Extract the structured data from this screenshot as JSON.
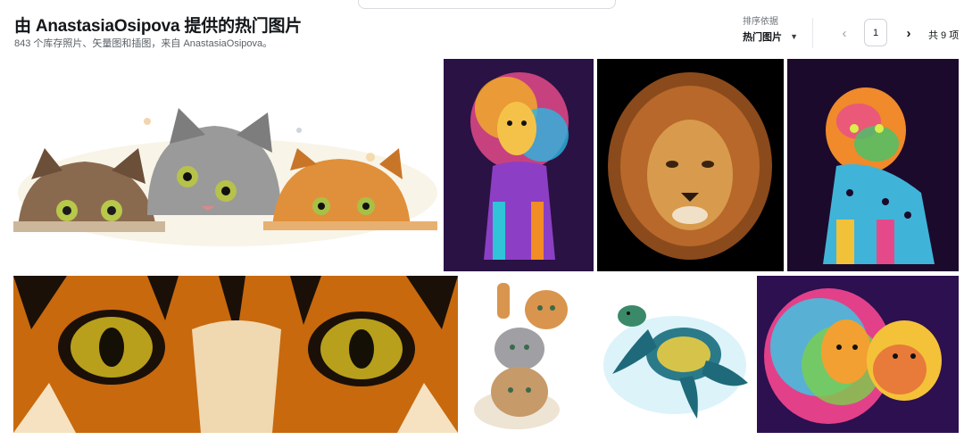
{
  "header": {
    "title": "由 AnastasiaOsipova 提供的热门图片",
    "subtitle": "843 个库存照片、矢量图和插图，来自 AnastasiaOsipova。"
  },
  "sort": {
    "label": "排序依据",
    "selected": "热门图片"
  },
  "pagination": {
    "current_page": "1",
    "total_text": "共 9 项"
  },
  "gallery": {
    "images": [
      {
        "subject": "three-kittens-peeking",
        "background": "#ffffff"
      },
      {
        "subject": "colorful-walking-lion",
        "background": "#2a1244"
      },
      {
        "subject": "lion-head-portrait",
        "background": "#000000"
      },
      {
        "subject": "neon-leopard",
        "background": "#1c0a2c"
      },
      {
        "subject": "tiger-eyes-closeup",
        "background": "#c8690e"
      },
      {
        "subject": "stacked-kittens",
        "background": "#ffffff"
      },
      {
        "subject": "sea-turtle-watercolor",
        "background": "#ffffff"
      },
      {
        "subject": "rainbow-lion-and-lioness",
        "background": "#2c1050"
      }
    ]
  }
}
